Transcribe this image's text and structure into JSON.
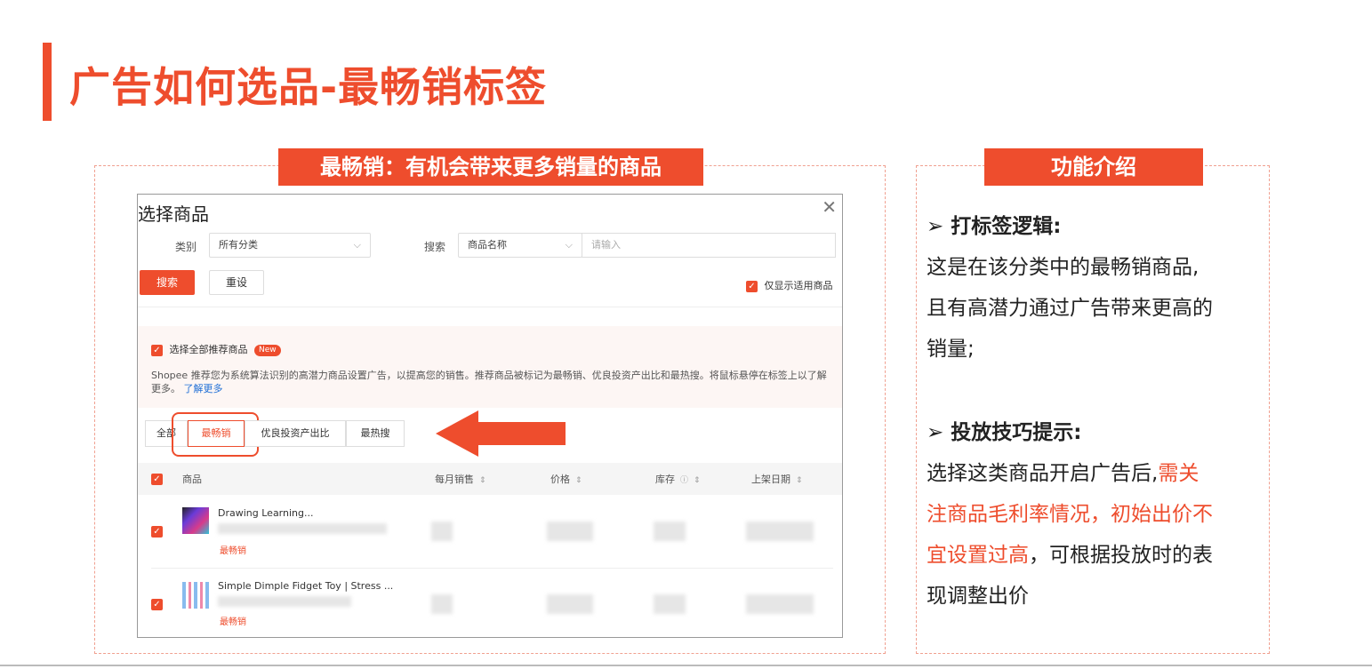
{
  "slide": {
    "title": "广告如何选品-最畅销标签"
  },
  "left_panel": {
    "banner": "最畅销：有机会带来更多销量的商品"
  },
  "modal": {
    "title": "选择商品",
    "close_icon": "close-icon",
    "category_label": "类别",
    "category_value": "所有分类",
    "search_label": "搜索",
    "search_field_value": "商品名称",
    "search_placeholder": "请输入",
    "search_button": "搜索",
    "reset_button": "重设",
    "only_show_label": "仅显示适用商品",
    "select_all_label": "选择全部推荐商品",
    "new_badge": "New",
    "rec_desc": "Shopee 推荐您为系统算法识别的高潜力商品设置广告，以提高您的销售。推荐商品被标记为最畅销、优良投资产出比和最热搜。将鼠标悬停在标签上以了解更多。",
    "learn_more": "了解更多",
    "tabs": [
      "全部",
      "最畅销",
      "优良投资产出比",
      "最热搜"
    ],
    "columns": [
      "商品",
      "每月销售",
      "价格",
      "库存",
      "上架日期"
    ],
    "rows": [
      {
        "name": "Drawing Learning...",
        "tag": "最畅销"
      },
      {
        "name": "Simple Dimple Fidget Toy | Stress ...",
        "tag": "最畅销"
      }
    ]
  },
  "right_panel": {
    "banner": "功能介绍",
    "section1_title": "打标签逻辑:",
    "section1_lines": [
      "这是在该分类中的最畅销商品,",
      "且有高潜力通过广告带来更高的",
      "销量;"
    ],
    "section2_title": "投放技巧提示:",
    "section2_line1_a": "选择这类商品开启广告后,",
    "section2_line1_b": "需关",
    "section2_line2": "注商品毛利率情况，初始出价不",
    "section2_line3_a": "宜设置过高",
    "section2_line3_b": "，可根据投放时的表",
    "section2_line4": "现调整出价"
  },
  "colors": {
    "accent": "#ee4d2d"
  }
}
